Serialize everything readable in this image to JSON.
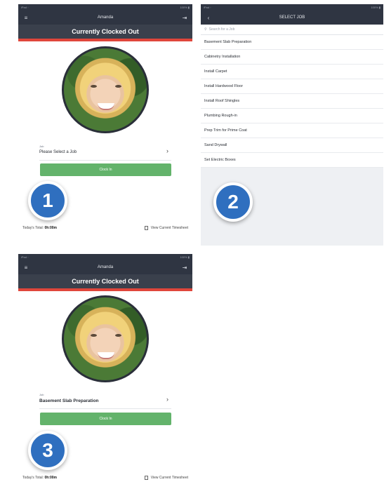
{
  "status_bar": {
    "left": "iPad  ◦",
    "right": "100% ▮"
  },
  "clock_screen": {
    "user_name": "Amanda",
    "banner": "Currently Clocked Out",
    "job_label": "Job",
    "job_placeholder": "Please Select a Job",
    "clock_in_label": "Clock In",
    "today_total_label": "Today's Total:",
    "today_total_value": "0h:00m",
    "view_timesheet_label": "View Current Timesheet"
  },
  "select_job_screen": {
    "title": "SELECT JOB",
    "search_placeholder": "Search for a Job",
    "jobs": [
      "Basement Slab Preparation",
      "Cabinetry Installation",
      "Install Carpet",
      "Install Hardwood Floor",
      "Install Roof Shingles",
      "Plumbing Rough-in",
      "Prep Trim for Prime Coat",
      "Sand Drywall",
      "Set Electric Boxes"
    ]
  },
  "selected_job": "Basement Slab Preparation",
  "step_badges": [
    "1",
    "2",
    "3"
  ],
  "colors": {
    "accent_red": "#e0463b",
    "button_green": "#63b36b",
    "nav_dark": "#2f3542",
    "badge_blue": "#2f6fbf"
  },
  "icons": {
    "menu": "hamburger-icon",
    "logout": "logout-icon",
    "back": "chevron-left-icon",
    "chevron": "chevron-right-icon",
    "search": "search-icon",
    "timesheet": "document-icon"
  }
}
